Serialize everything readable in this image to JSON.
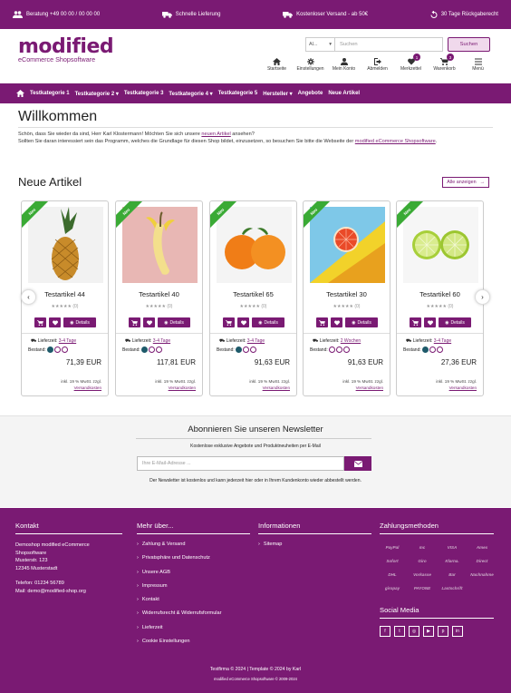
{
  "topbar": {
    "hotline": "Beratung +49 00 00 / 00 00 00",
    "delivery": "Schnelle Lieferung",
    "shipping": "Kostenloser Versand - ab 50€",
    "returns": "30 Tage Rückgaberecht"
  },
  "logo": {
    "wordmark": "modified",
    "sub": "eCommerce Shopsoftware"
  },
  "search": {
    "select": "Al...",
    "placeholder": "Suchen",
    "button": "Suchen"
  },
  "header_nav": [
    {
      "label": "Startseite",
      "icon": "home-icon"
    },
    {
      "label": "Einstellungen",
      "icon": "gear-icon"
    },
    {
      "label": "Mein Konto",
      "icon": "user-icon"
    },
    {
      "label": "Abmelden",
      "icon": "logout-icon"
    },
    {
      "label": "Merkzettel",
      "icon": "heart-icon",
      "badge": "1"
    },
    {
      "label": "Warenkorb",
      "icon": "cart-icon",
      "badge": "3"
    },
    {
      "label": "Menü",
      "icon": "menu-icon"
    }
  ],
  "categories": [
    "Testkategorie 1",
    "Testkategorie 2 ▾",
    "Testkategorie 3",
    "Testkategorie 4 ▾",
    "Testkategorie 5",
    "Hersteller ▾",
    "Angebote",
    "Neue Artikel"
  ],
  "main": {
    "title": "Willkommen",
    "intro_1a": "Schön, dass Sie wieder da sind, Herr Karl Klostermann! Möchten Sie sich unsere ",
    "intro_1link": "neuen Artikel",
    "intro_1b": " ansehen?",
    "intro_2a": "Sollten Sie daran interessiert sein das Programm, welches die Grundlage für diesen Shop bildet, einzusetzen, so besuchen Sie bitte die Webseite der ",
    "intro_2link": "modified eCommerce Shopsoftware",
    "intro_2b": "."
  },
  "new_articles": {
    "title": "Neue Artikel",
    "all_button": "Alle anzeigen",
    "ribbon": "Neu",
    "details": "Details",
    "delivery_label": "Lieferzeit:",
    "stock_label": "Bestand:",
    "tax_line": "inkl. 19 % MwSt. zzgl.",
    "shipping_link": "Versandkosten",
    "products": [
      {
        "name": "Testartikel 44",
        "rating": "(0)",
        "delivery": "3-4 Tage",
        "price": "71,39 EUR",
        "stock_level": 1,
        "image": "pineapple"
      },
      {
        "name": "Testartikel 40",
        "rating": "(0)",
        "delivery": "3-4 Tage",
        "price": "117,81 EUR",
        "stock_level": 1,
        "image": "banana"
      },
      {
        "name": "Testartikel 65",
        "rating": "(0)",
        "delivery": "3-4 Tage",
        "price": "91,63 EUR",
        "stock_level": 1,
        "image": "oranges"
      },
      {
        "name": "Testartikel 30",
        "rating": "(0)",
        "delivery": "2 Wochen",
        "price": "91,63 EUR",
        "stock_level": 0,
        "image": "grapefruit"
      },
      {
        "name": "Testartikel 60",
        "rating": "(0)",
        "delivery": "3-4 Tage",
        "price": "27,36 EUR",
        "stock_level": 1,
        "image": "lime"
      }
    ]
  },
  "newsletter": {
    "title": "Abonnieren Sie unseren Newsletter",
    "subtitle": "Kostenlose exklusive Angebote und Produktneuheiten per E-Mail",
    "placeholder": "Ihre E-Mail-Adresse ...",
    "note": "Der Newsletter ist kostenlos und kann jederzeit hier oder in Ihrem Kundenkonto wieder abbestellt werden."
  },
  "footer": {
    "contact": {
      "title": "Kontakt",
      "lines": [
        "Demoshop modified eCommerce",
        "Shopsoftware",
        "Musterstr. 123",
        "12345 Musterstadt"
      ],
      "phone": "Telefon: 01234 56789",
      "mail": "Mail: demo@modified-shop.org"
    },
    "more": {
      "title": "Mehr über...",
      "links": [
        "Zahlung & Versand",
        "Privatsphäre und Datenschutz",
        "Unsere AGB",
        "Impressum",
        "Kontakt",
        "Widerrufsrecht & Widerrufsformular",
        "Lieferzeit",
        "Cookie Einstellungen"
      ]
    },
    "info": {
      "title": "Informationen",
      "links": [
        "Sitemap"
      ]
    },
    "payment": {
      "title": "Zahlungsmethoden",
      "logos": [
        "PayPal",
        "mc",
        "VISA",
        "Amex",
        "Sofort",
        "Giro",
        "Klarna.",
        "Direct",
        "DHL",
        "Vorkasse",
        "Bar",
        "Nachnahme",
        "giropay",
        "PAYONE",
        "Lastschrift",
        ""
      ]
    },
    "social": {
      "title": "Social Media",
      "icons": [
        "facebook-icon",
        "twitter-icon",
        "instagram-icon",
        "youtube-icon",
        "pinterest-icon",
        "linkedin-icon"
      ]
    },
    "copyright": "Testfirma © 2024 | Template © 2024 by Karl",
    "powered": "modified eCommerce Shopsoftware © 2009-2024"
  },
  "colors": {
    "brand": "#7a1a73",
    "ribbon": "#3aaa35"
  }
}
